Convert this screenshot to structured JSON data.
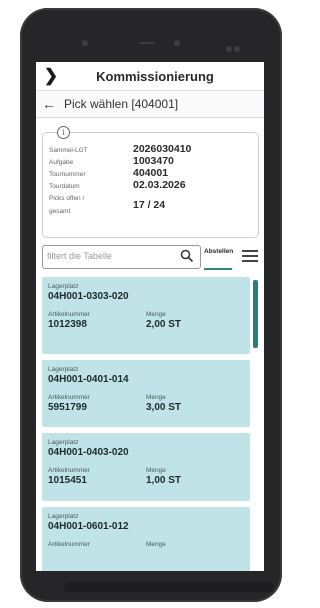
{
  "app": {
    "title": "Kommissionierung",
    "subtitle": "Pick wählen [404001]"
  },
  "info": {
    "rows": [
      {
        "label": "Sammel-LGT",
        "value": "2026030410"
      },
      {
        "label": "Aufgabe",
        "value": "1003470"
      },
      {
        "label": "Tournummer",
        "value": "404001"
      },
      {
        "label": "Tourdatum",
        "value": "02.03.2026"
      },
      {
        "label": "Picks offen /",
        "label2": "gesamt",
        "value": "17 / 24"
      }
    ]
  },
  "search": {
    "placeholder": "filtert die Tabelle",
    "abstellen_label": "Abstellen"
  },
  "cards": {
    "labels": {
      "lagerplatz": "Lagerplatz",
      "artikelnummer": "Artikelnummer",
      "menge": "Menge"
    },
    "items": [
      {
        "lagerplatz": "04H001-0303-020",
        "artikelnummer": "1012398",
        "menge": "2,00 ST"
      },
      {
        "lagerplatz": "04H001-0401-014",
        "artikelnummer": "5951799",
        "menge": "3,00 ST"
      },
      {
        "lagerplatz": "04H001-0403-020",
        "artikelnummer": "1015451",
        "menge": "1,00 ST"
      },
      {
        "lagerplatz": "04H001-0601-012",
        "artikelnummer": "",
        "menge": ""
      }
    ]
  },
  "colors": {
    "card": "#bfe3e6",
    "accent": "#2c8787",
    "phone": "#262628"
  }
}
